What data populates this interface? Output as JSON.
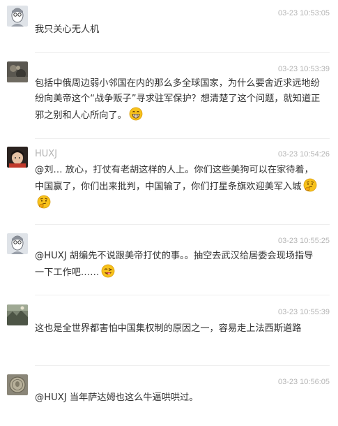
{
  "comments": [
    {
      "name": "",
      "time": "03-23 10:53:05",
      "text": "我只关心无人机",
      "avatar_icon": "user-avatar-sketch"
    },
    {
      "name": "",
      "time": "03-23 10:53:39",
      "text": "包括中俄周边弱小邻国在内的那么多全球国家，为什么要舍近求远地纷纷向美帝这个“战争贩子”寻求驻军保护？想清楚了这个问题，就知道正邪之别和人心所向了。",
      "avatar_icon": "user-avatar-dark",
      "emoji": "grinning-emoji"
    },
    {
      "name": "HUXJ",
      "time": "03-23 10:54:26",
      "text": "@刘… 放心，打仗有老胡这样的人上。你们这些美狗可以在家待着，中国赢了，你们出来批判，中国输了，你们打星条旗欢迎美军入城",
      "avatar_icon": "user-avatar-photo",
      "emoji": "thinking-emoji"
    },
    {
      "name": "",
      "time": "03-23 10:55:25",
      "text": "@HUXJ 胡编先不说跟美帝打仗的事。。抽空去武汉给居委会现场指导一下工作吧……",
      "avatar_icon": "user-avatar-sketch",
      "emoji": "winking-emoji"
    },
    {
      "name": "",
      "time": "03-23 10:55:39",
      "text": "这也是全世界都害怕中国集权制的原因之一，容易走上法西斯道路",
      "avatar_icon": "user-avatar-landscape"
    },
    {
      "name": "",
      "time": "03-23 10:56:05",
      "text": "@HUXJ 当年萨达姆也这么牛逼哄哄过。",
      "avatar_icon": "user-avatar-coin"
    }
  ]
}
